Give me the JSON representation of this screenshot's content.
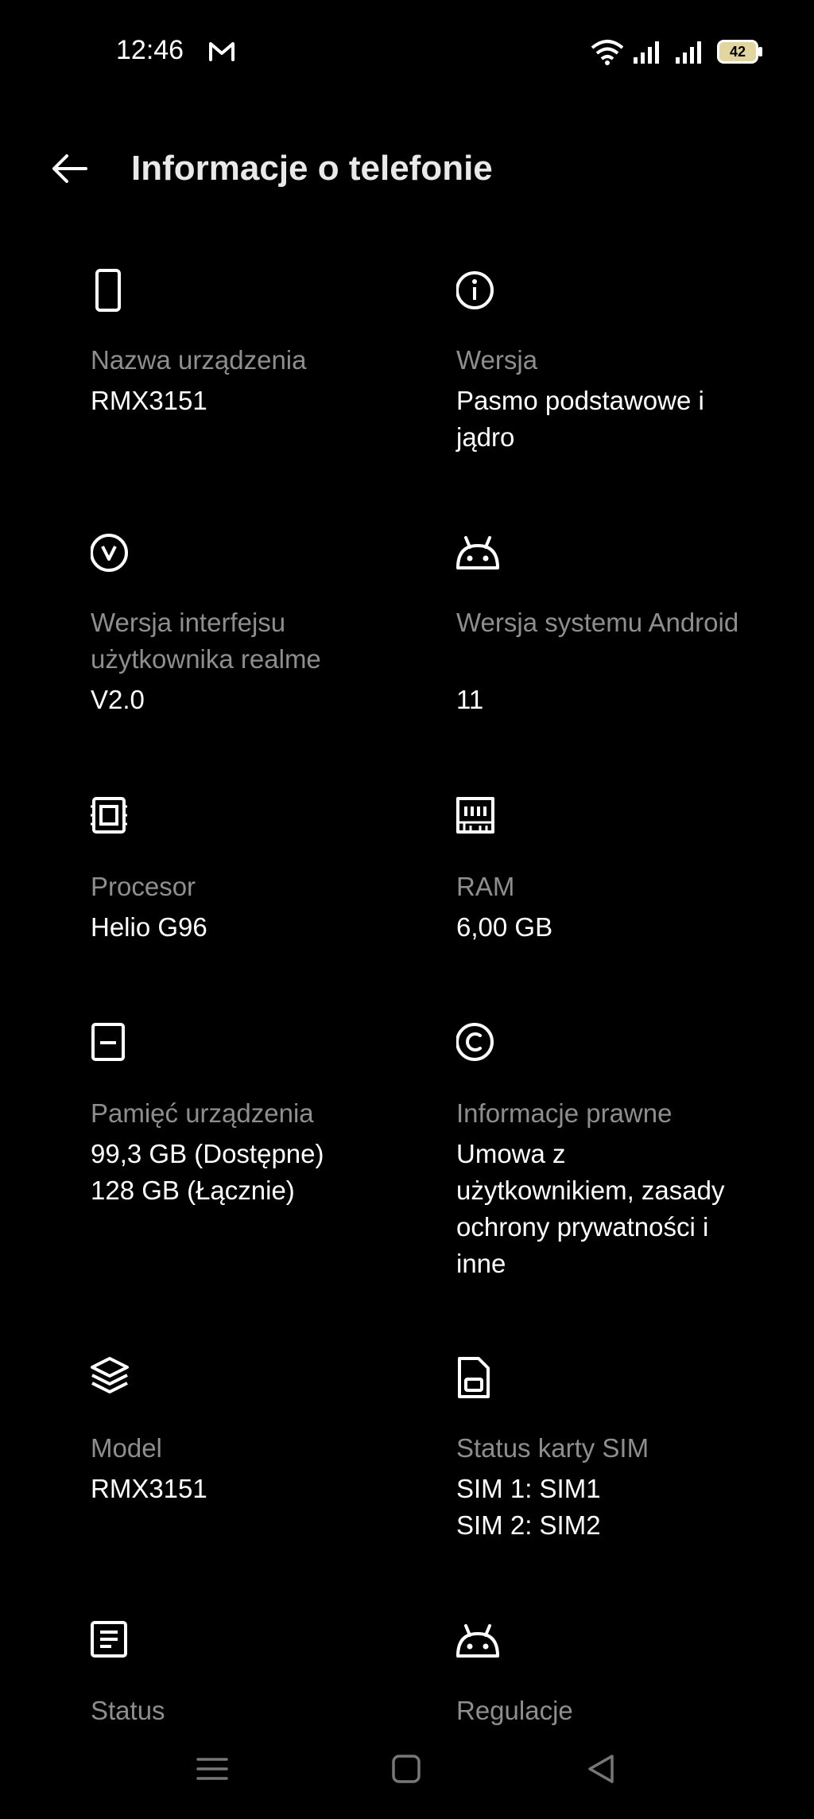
{
  "status_bar": {
    "time": "12:46",
    "notification_icon": "gmail-icon",
    "battery_level": "42",
    "battery_color": "#e2d6a0"
  },
  "header": {
    "title": "Informacje o telefonie",
    "back_icon": "arrow-left-icon"
  },
  "items": [
    {
      "icon": "phone-icon",
      "label": "Nazwa urządzenia",
      "value": "RMX3151"
    },
    {
      "icon": "info-icon",
      "label": "Wersja",
      "value": "Pasmo podstawowe i jądro"
    },
    {
      "icon": "realme-ui-icon",
      "label": "Wersja interfejsu użytkownika realme",
      "value": "V2.0"
    },
    {
      "icon": "android-icon",
      "label": "Wersja systemu Android",
      "value": "11"
    },
    {
      "icon": "chip-icon",
      "label": "Procesor",
      "value": "Helio G96"
    },
    {
      "icon": "ram-icon",
      "label": "RAM",
      "value": "6,00 GB"
    },
    {
      "icon": "storage-icon",
      "label": "Pamięć urządzenia",
      "value": "99,3 GB (Dostępne)\n128 GB (Łącznie)"
    },
    {
      "icon": "copyright-icon",
      "label": "Informacje prawne",
      "value": "Umowa z użytkownikiem, zasady ochrony prywatności i inne"
    },
    {
      "icon": "layers-icon",
      "label": "Model",
      "value": "RMX3151"
    },
    {
      "icon": "sim-card-icon",
      "label": "Status karty SIM",
      "value": "SIM 1: SIM1\nSIM 2: SIM2"
    },
    {
      "icon": "document-icon",
      "label": "Status",
      "value": ""
    },
    {
      "icon": "android-icon",
      "label": "Regulacje",
      "value": ""
    }
  ],
  "nav_bar": {
    "buttons": [
      "menu-icon",
      "home-icon",
      "back-triangle-icon"
    ]
  }
}
